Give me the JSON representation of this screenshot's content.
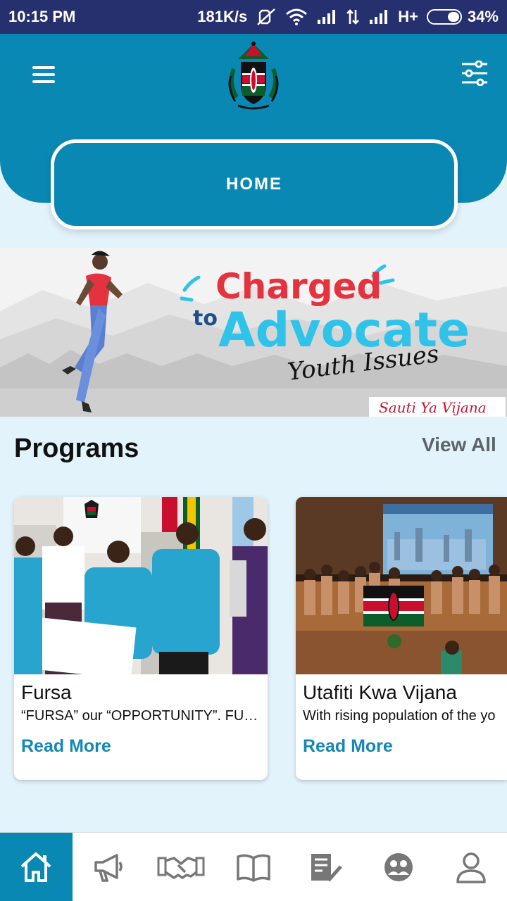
{
  "status_bar": {
    "time": "10:15 PM",
    "network_speed": "181K/s",
    "network_type": "H+",
    "battery": "34%",
    "battery_level": 0.34,
    "icons": [
      "mute-vibrate-icon",
      "wifi-icon",
      "signal-icon",
      "data-transfer-icon",
      "signal-icon",
      "battery-icon"
    ]
  },
  "header": {
    "menu_icon": "hamburger-menu-icon",
    "logo": "coat-of-arms-logo",
    "filter_icon": "sliders-filter-icon",
    "color": "#0a88b4"
  },
  "nav_pill": {
    "label": "HOME"
  },
  "banner": {
    "line1": "Charged",
    "line2_prefix": "to",
    "line2": "Advocate",
    "line3": "Youth Issues",
    "tag": "Sauti Ya Vijana"
  },
  "programs": {
    "title": "Programs",
    "view_all": "View All",
    "items": [
      {
        "title": "Fursa",
        "description": "“FURSA” our “OPPORTUNITY”.     FU…",
        "cta": "Read More"
      },
      {
        "title": "Utafiti Kwa Vijana",
        "description": "With rising population of the yo",
        "cta": "Read More"
      }
    ]
  },
  "bottom_nav": {
    "items": [
      {
        "icon": "home-icon",
        "active": true
      },
      {
        "icon": "megaphone-icon",
        "active": false
      },
      {
        "icon": "handshake-icon",
        "active": false
      },
      {
        "icon": "book-icon",
        "active": false
      },
      {
        "icon": "checklist-icon",
        "active": false
      },
      {
        "icon": "group-icon",
        "active": false
      },
      {
        "icon": "profile-icon",
        "active": false
      }
    ]
  },
  "colors": {
    "primary": "#0a88b4",
    "status_bar": "#27306f",
    "background": "#e3f3fb",
    "link": "#1587b4",
    "banner_red": "#e5323f",
    "banner_cyan": "#2fc3ea"
  }
}
